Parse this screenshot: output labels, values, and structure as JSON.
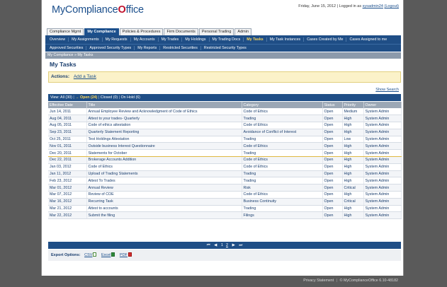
{
  "header": {
    "logo_text": "MyCompliance",
    "logo_check": "O",
    "logo_text_end": "ffice",
    "date": "Friday, June 15, 2012",
    "logged_in_as": "| Logged in as",
    "username": "sysadmin24",
    "logout_label": "(Logout)"
  },
  "module_tabs": [
    {
      "label": "Compliance Mgmt",
      "active": false
    },
    {
      "label": "My Compliance",
      "active": true
    },
    {
      "label": "Policies & Procedures",
      "active": false
    },
    {
      "label": "Firm Documents",
      "active": false
    },
    {
      "label": "Personal Trading",
      "active": false
    },
    {
      "label": "Admin",
      "active": false
    }
  ],
  "nav_row1": [
    {
      "label": "Overview",
      "active": false
    },
    {
      "label": "My Assignments",
      "active": false
    },
    {
      "label": "My Requests",
      "active": false
    },
    {
      "label": "My Accounts",
      "active": false
    },
    {
      "label": "My Trades",
      "active": false
    },
    {
      "label": "My Holdings",
      "active": false
    },
    {
      "label": "My Trading Docs",
      "active": false
    },
    {
      "label": "My Tasks",
      "active": true
    },
    {
      "label": "My Task Instances",
      "active": false
    },
    {
      "label": "Cases Created by Me",
      "active": false
    },
    {
      "label": "Cases Assigned to me",
      "active": false
    }
  ],
  "nav_row2": [
    {
      "label": "Approved Securities",
      "active": false
    },
    {
      "label": "Approved Security Types",
      "active": false
    },
    {
      "label": "My Reports",
      "active": false
    },
    {
      "label": "Restricted Securities",
      "active": false
    },
    {
      "label": "Restricted Security Types",
      "active": false
    }
  ],
  "breadcrumb": "My Compliance  »  My Tasks",
  "page_title": "My Tasks",
  "actions": {
    "label": "Actions:",
    "add_task": "Add a Task"
  },
  "show_search": "Show Search",
  "filters": {
    "view_all": "View: All (30)",
    "sep": "|",
    "arrow": "→",
    "open": "Open (24)",
    "closed": "Closed (0)",
    "on_hold": "On Hold (6)"
  },
  "table": {
    "columns": [
      "Effective Date",
      "Title",
      "Category",
      "Status",
      "Priority",
      "Owner"
    ],
    "rows": [
      [
        "Jun 14, 2011",
        "Annual Employee Review and Acknowledgment of Code of Ethics",
        "Code of Ethics",
        "Open",
        "Medium",
        "System Admin"
      ],
      [
        "Aug 04, 2011",
        "Attest to your trades- Quarterly",
        "Trading",
        "Open",
        "High",
        "System Admin"
      ],
      [
        "Aug 05, 2011",
        "Code of ethics attestation",
        "Code of Ethics",
        "Open",
        "High",
        "System Admin"
      ],
      [
        "Sep 23, 2011",
        "Quarterly Statement Reporting",
        "Avoidance of Conflict of Interest",
        "Open",
        "High",
        "System Admin"
      ],
      [
        "Oct 25, 2011",
        "Test Holdings Attestation",
        "Trading",
        "Open",
        "Low",
        "System Admin"
      ],
      [
        "Nov 01, 2011",
        "Outside business Interest Questionnaire",
        "Code of Ethics",
        "Open",
        "High",
        "System Admin"
      ],
      [
        "Dec 20, 2011",
        "Statements for October",
        "Trading",
        "Open",
        "High",
        "System Admin"
      ],
      [
        "Dec 22, 2011",
        "Brokerage Accounts Addition",
        "Code of Ethics",
        "Open",
        "High",
        "System Admin"
      ],
      [
        "Jan 03, 2012",
        "Code of Ethics",
        "Code of Ethics",
        "Open",
        "High",
        "System Admin"
      ],
      [
        "Jan 11, 2012",
        "Upload of Trading Statements",
        "Trading",
        "Open",
        "High",
        "System Admin"
      ],
      [
        "Feb 23, 2012",
        "Attest To Trades",
        "Trading",
        "Open",
        "High",
        "System Admin"
      ],
      [
        "Mar 01, 2012",
        "Annual Review",
        "Risk",
        "Open",
        "Critical",
        "System Admin"
      ],
      [
        "Mar 07, 2012",
        "Review of COE",
        "Code of Ethics",
        "Open",
        "High",
        "System Admin"
      ],
      [
        "Mar 16, 2012",
        "Recurring Task",
        "Business Continuity",
        "Open",
        "Critical",
        "System Admin"
      ],
      [
        "Mar 21, 2012",
        "Attest to accounts",
        "Trading",
        "Open",
        "High",
        "System Admin"
      ],
      [
        "Mar 22, 2012",
        "Submit the filing",
        "Filings",
        "Open",
        "High",
        "System Admin"
      ]
    ]
  },
  "pager": {
    "first": "⏮",
    "prev": "◀",
    "page1": "1",
    "page2": "2",
    "next": "▶",
    "last": "⏭"
  },
  "export": {
    "label": "Export Options:",
    "csv": "CSV",
    "excel": "Excel",
    "pdf": "PDF"
  },
  "footer": {
    "privacy": "Privacy Statement",
    "sep": "|",
    "copyright": "© MyComplianceOffice 6.10-48182"
  }
}
